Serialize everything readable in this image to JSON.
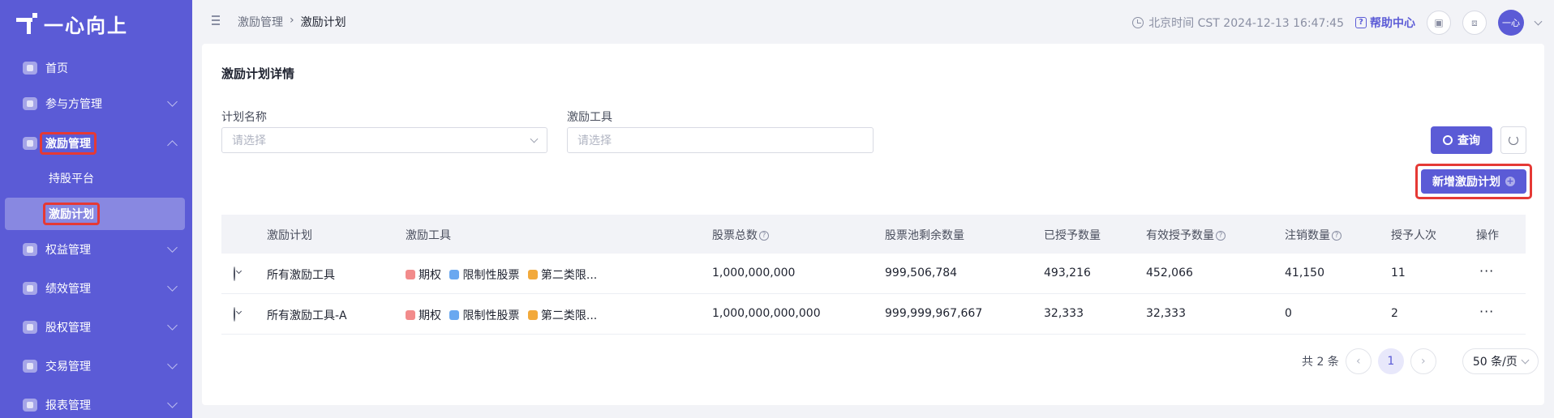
{
  "app": {
    "logo_text": "一心向上"
  },
  "sidebar": {
    "items": [
      {
        "label": "首页"
      },
      {
        "label": "参与方管理"
      },
      {
        "label": "激励管理"
      },
      {
        "label": "权益管理"
      },
      {
        "label": "绩效管理"
      },
      {
        "label": "股权管理"
      },
      {
        "label": "交易管理"
      },
      {
        "label": "报表管理"
      }
    ],
    "sub_items": [
      {
        "label": "持股平台"
      },
      {
        "label": "激励计划"
      }
    ]
  },
  "header": {
    "breadcrumb": [
      "激励管理",
      "激励计划"
    ],
    "clock_text": "北京时间 CST 2024-12-13 16:47:45",
    "help_label": "帮助中心",
    "avatar_text": "一心"
  },
  "main": {
    "title": "激励计划详情",
    "filters": [
      {
        "label": "计划名称",
        "placeholder": "请选择"
      },
      {
        "label": "激励工具",
        "placeholder": "请选择"
      }
    ],
    "query_label": "查询",
    "new_label": "新增激励计划",
    "table": {
      "columns": [
        "激励计划",
        "激励工具",
        "股票总数",
        "股票池剩余数量",
        "已授予数量",
        "有效授予数量",
        "注销数量",
        "授予人次",
        "操作"
      ],
      "tools": [
        "期权",
        "限制性股票",
        "第二类限..."
      ],
      "rows": [
        {
          "plan": "所有激励工具",
          "total": "1,000,000,000",
          "remaining": "999,506,784",
          "granted": "493,216",
          "effective": "452,066",
          "cancelled": "41,150",
          "people": "11"
        },
        {
          "plan": "所有激励工具-A",
          "total": "1,000,000,000,000",
          "remaining": "999,999,967,667",
          "granted": "32,333",
          "effective": "32,333",
          "cancelled": "0",
          "people": "2"
        }
      ]
    },
    "pagination": {
      "total_text": "共 2 条",
      "current_page": "1",
      "page_size": "50 条/页"
    }
  },
  "colors": {
    "brand": "#5b5bd6",
    "highlight": "#e53935"
  }
}
